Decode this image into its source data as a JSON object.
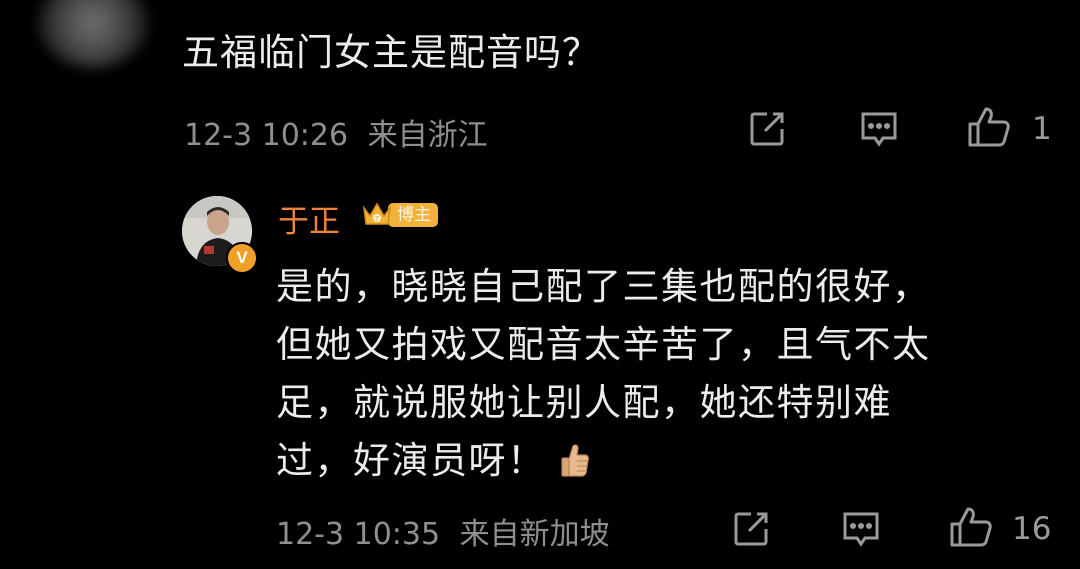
{
  "comment": {
    "text": "五福临门女主是配音吗？",
    "timestamp": "12-3 10:26",
    "location": "来自浙江",
    "like_count": "1"
  },
  "reply": {
    "author": "于正",
    "author_badge": "博主",
    "lines": [
      "是的，晓晓自己配了三集也配的很好，",
      "但她又拍戏又配音太辛苦了，且气不太",
      "足，就说服她让别人配，她还特别难",
      "过，好演员呀！"
    ],
    "emoji": "thumbs-up-emoji",
    "timestamp": "12-3 10:35",
    "location": "来自新加坡",
    "like_count": "16"
  },
  "icons": {
    "share": "share-icon",
    "comment": "comment-icon",
    "like": "like-icon",
    "verified": "verified-v-icon",
    "crown": "crown-icon"
  },
  "colors": {
    "background": "#000000",
    "username": "#f0843c",
    "badge": "#f0b23a",
    "meta_text": "#8f8f8f"
  },
  "verified_mark": "V"
}
